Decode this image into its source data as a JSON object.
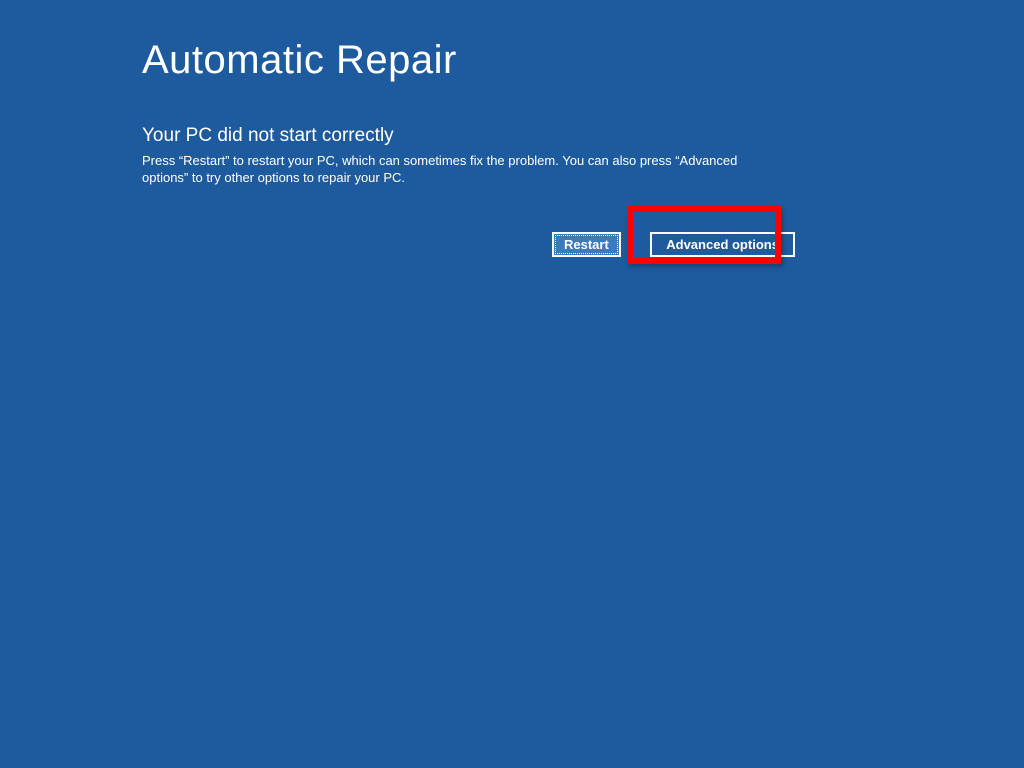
{
  "title": "Automatic Repair",
  "subtitle": "Your PC did not start correctly",
  "description": "Press “Restart” to restart your PC, which can sometimes fix the problem. You can also press “Advanced options” to try other options to repair your PC.",
  "buttons": {
    "restart": "Restart",
    "advanced": "Advanced options"
  }
}
